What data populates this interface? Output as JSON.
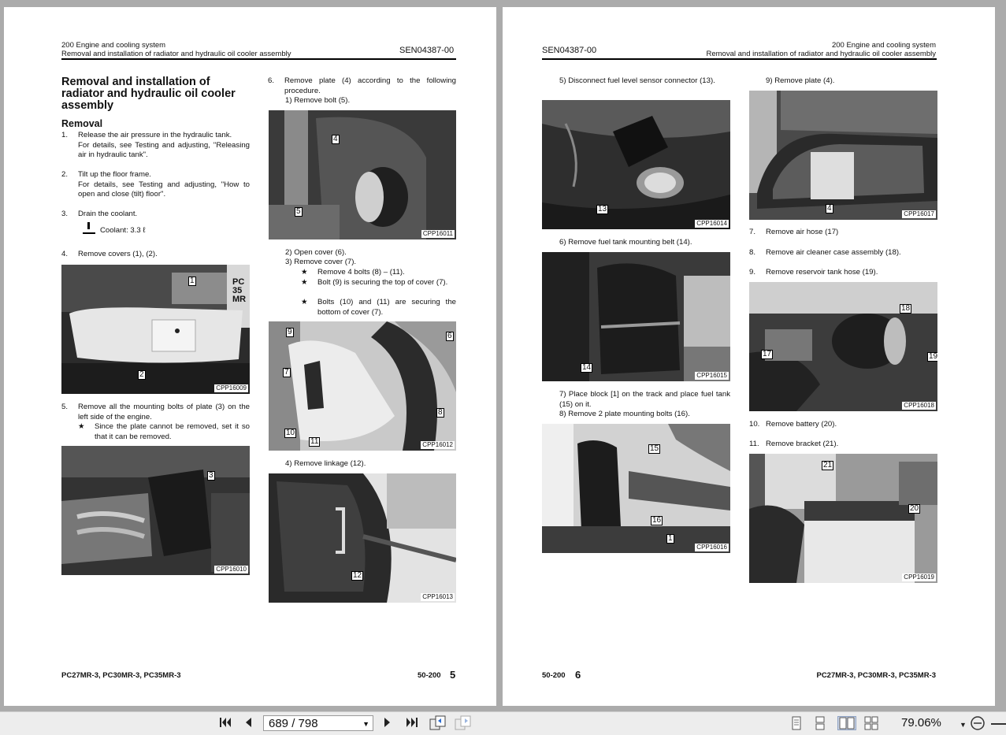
{
  "left": {
    "hdr_section": "200 Engine and cooling system",
    "hdr_sub": "Removal and installation of radiator and hydraulic oil cooler assembly",
    "hdr_doc": "SEN04387-00",
    "title": "Removal and installation of radiator and hydraulic oil cooler assembly",
    "subtitle": "Removal",
    "s1_num": "1.",
    "s1_a": "Release the air pressure in the hydraulic tank.",
    "s1_b": "For details, see Testing and adjusting, \"Releasing air in hydraulic tank\".",
    "s2_num": "2.",
    "s2_a": "Tilt up the floor frame.",
    "s2_b": "For details, see Testing and adjusting, \"How to open and close (tilt) floor\".",
    "s3_num": "3.",
    "s3_a": "Drain the coolant.",
    "coolant": "Coolant: 3.3 ℓ",
    "s4_num": "4.",
    "s4_a": "Remove covers (1), (2).",
    "s5_num": "5.",
    "s5_a": "Remove all the mounting bolts of plate (3) on the left side of the engine.",
    "s5_note": "Since the plate cannot be removed, set it so that it can be removed.",
    "s6_num": "6.",
    "s6_a": "Remove plate (4) according to the following procedure.",
    "s6_1": "1)  Remove bolt (5).",
    "s6_2": "2)  Open cover (6).",
    "s6_3": "3)  Remove cover (7).",
    "s6_3a": "Remove 4 bolts (8) – (11).",
    "s6_3b": "Bolt (9) is securing the top of cover (7).",
    "s6_3c": "Bolts (10) and (11) are securing the bottom of cover (7).",
    "s6_4": "4)  Remove linkage (12).",
    "img_codes": [
      "CPP16009",
      "CPP16010",
      "CPP16011",
      "CPP16012",
      "CPP16013"
    ],
    "foot_models": "PC27MR-3, PC30MR-3, PC35MR-3",
    "foot_code": "50-200",
    "foot_page": "5"
  },
  "right": {
    "hdr_section": "200 Engine and cooling system",
    "hdr_sub": "Removal and installation of radiator and hydraulic oil cooler assembly",
    "hdr_doc": "SEN04387-00",
    "s5": "5)  Disconnect fuel level sensor connector (13).",
    "s6": "6)  Remove fuel tank mounting belt (14).",
    "s7": "7)  Place block [1] on the track and place fuel tank (15) on it.",
    "s8": "8)  Remove 2 plate mounting bolts (16).",
    "s9": "9)  Remove plate (4).",
    "n7_num": "7.",
    "n7": "Remove air hose (17)",
    "n8_num": "8.",
    "n8": "Remove air cleaner case assembly (18).",
    "n9_num": "9.",
    "n9": "Remove reservoir tank hose (19).",
    "n10_num": "10.",
    "n10": "Remove battery (20).",
    "n11_num": "11.",
    "n11": "Remove bracket (21).",
    "img_codes": [
      "CPP16014",
      "CPP16015",
      "CPP16016",
      "CPP16017",
      "CPP16018",
      "CPP16019"
    ],
    "foot_code": "50-200",
    "foot_page": "6",
    "foot_models": "PC27MR-3, PC30MR-3, PC35MR-3"
  },
  "callouts": {
    "c1": "1",
    "c2": "2",
    "c3": "3",
    "c4": "4",
    "c5": "5",
    "c6": "6",
    "c7": "7",
    "c8": "8",
    "c9": "9",
    "c10": "10",
    "c11": "11",
    "c12": "12",
    "c13": "13",
    "c14": "14",
    "c15": "15",
    "c16": "16",
    "cb1": "1",
    "c4b": "4",
    "c17": "17",
    "c18": "18",
    "c19": "19",
    "c20": "20",
    "c21": "21",
    "decal": "PC 35 MR"
  },
  "toolbar": {
    "page_indicator": "689 / 798",
    "zoom": "79.06%"
  }
}
